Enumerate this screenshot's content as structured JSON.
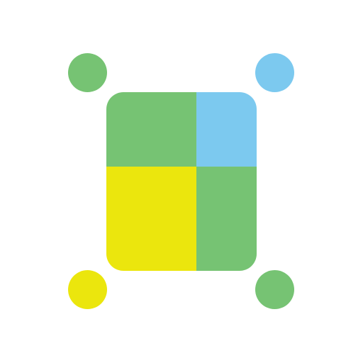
{
  "logo": {
    "colors": {
      "green": "#76c373",
      "blue": "#7cc9ef",
      "yellow": "#ebe60d",
      "background": "#ffffff"
    },
    "corner_dots": [
      {
        "name": "top-left-dot",
        "color": "#76c373"
      },
      {
        "name": "top-right-dot",
        "color": "#7cc9ef"
      },
      {
        "name": "bottom-left-dot",
        "color": "#ebe60d"
      },
      {
        "name": "bottom-right-dot",
        "color": "#76c373"
      }
    ],
    "tiles": [
      {
        "name": "top-left-tile",
        "color": "#76c373"
      },
      {
        "name": "top-right-tile",
        "color": "#7cc9ef"
      },
      {
        "name": "bottom-left-tile",
        "color": "#ebe60d"
      },
      {
        "name": "bottom-right-tile",
        "color": "#76c373"
      }
    ]
  }
}
